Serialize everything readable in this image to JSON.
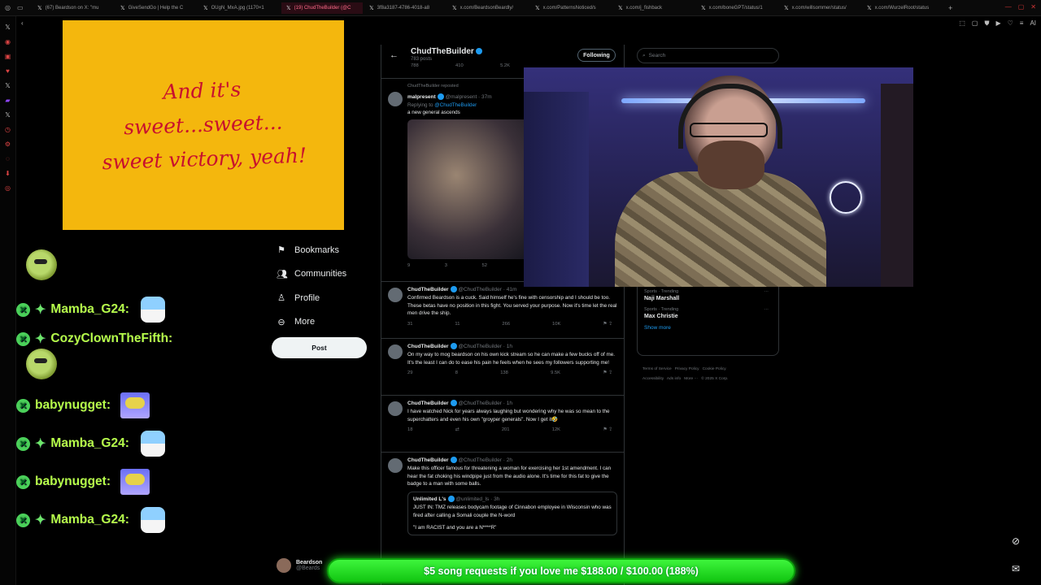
{
  "browser": {
    "tabs": [
      {
        "label": "(67) Beardson on X: \"mu",
        "active": false
      },
      {
        "label": "GiveSendGo | Help the C",
        "active": false
      },
      {
        "label": "OUgN_MxA.jpg (1170×1",
        "active": false
      },
      {
        "label": "(19) ChudTheBuilder (@C",
        "active": true
      },
      {
        "label": "3f8a3187-4786-4018-a8",
        "active": false
      },
      {
        "label": "x.com/BeardsonBeardly/",
        "active": false
      },
      {
        "label": "x.com/PatternsNoticed/s",
        "active": false
      },
      {
        "label": "x.com/j_fishback",
        "active": false
      },
      {
        "label": "x.com/boneGPT/status/1",
        "active": false
      },
      {
        "label": "x.com/willsommer/status/",
        "active": false
      },
      {
        "label": "x.com/WurzelRoot/status",
        "active": false
      }
    ],
    "ai_label": "AI"
  },
  "overlay_image": {
    "lines": [
      "And it's",
      "sweet...sweet...",
      "sweet victory, yeah!"
    ]
  },
  "chat": [
    {
      "user": "Mamba_G24:",
      "emote": "girl"
    },
    {
      "user": "CozyClownTheFifth:",
      "emote": "frog"
    },
    {
      "user": "babynugget:",
      "emote": "bot"
    },
    {
      "user": "Mamba_G24:",
      "emote": "girl"
    },
    {
      "user": "babynugget:",
      "emote": "bot"
    },
    {
      "user": "Mamba_G24:",
      "emote": "girl"
    }
  ],
  "x_nav": {
    "items": [
      {
        "label": "Bookmarks",
        "icon": "bookmark-icon"
      },
      {
        "label": "Communities",
        "icon": "people-icon"
      },
      {
        "label": "Profile",
        "icon": "person-icon"
      },
      {
        "label": "More",
        "icon": "more-circle-icon"
      }
    ],
    "post_label": "Post",
    "account_name": "Beardson",
    "account_handle": "@Beards"
  },
  "profile": {
    "name": "ChudTheBuilder",
    "posts_count": "783 posts",
    "following_label": "Following"
  },
  "search": {
    "placeholder": "Search"
  },
  "tweets": [
    {
      "reposted": "ChudTheBuilder reposted",
      "name": "malpresent",
      "handle": "@malpresent · 37m",
      "reply_to_prefix": "Replying to",
      "reply_to": "@ChudTheBuilder",
      "text": "a new general ascends",
      "has_image": true,
      "actions": [
        "9",
        "3",
        "52",
        "",
        ""
      ],
      "top_actions": [
        "788",
        "410",
        "5.2K",
        "",
        ""
      ]
    },
    {
      "name": "ChudTheBuilder",
      "handle": "@ChudTheBuilder · 41m",
      "text": "Confirmed Beardson is a cuck. Said himself he's fine with censorship and I should be too. These betas have no position in this fight. You served your purpose. Now it's time let the real men drive the ship.",
      "actions": [
        "31",
        "11",
        "266",
        "10K",
        ""
      ]
    },
    {
      "name": "ChudTheBuilder",
      "handle": "@ChudTheBuilder · 1h",
      "text": "On my way to mog beardson on his own kick stream so he can make a few bucks off of me. It's the least I can do to ease his pain he feels when he sees my followers supporting me!",
      "actions": [
        "29",
        "8",
        "138",
        "9.5K",
        ""
      ]
    },
    {
      "name": "ChudTheBuilder",
      "handle": "@ChudTheBuilder · 1h",
      "text": "I have watched Nick for years always laughing but wondering why he was so mean to the superchatters and even his own \"groyper generals\". Now I get it🤣",
      "actions": [
        "18",
        "",
        "201",
        "12K",
        ""
      ]
    },
    {
      "name": "ChudTheBuilder",
      "handle": "@ChudTheBuilder · 2h",
      "text": "Make this officer famous for threatening a woman for exercising her 1st amendment. I can hear the fat choking his windpipe just from the audio alone. It's time for this fat to give the badge to a man with some balls.",
      "quote": {
        "name": "Unlimited L's",
        "handle": "@unlimited_ls · 3h",
        "text": "JUST IN: TMZ releases bodycam footage of Cinnabon employee in Wisconsin who was fired after calling a Somali couple the N-word",
        "text2": "\"I am RACIST and you are a N****R\""
      }
    }
  ],
  "trends": [
    {
      "category": "Sports · Trending",
      "name": "Naji Marshall"
    },
    {
      "category": "Sports · Trending",
      "name": "Max Christie"
    }
  ],
  "show_more": "Show more",
  "footer": [
    "Terms of Service",
    "Privacy Policy",
    "Cookie Policy",
    "Accessibility",
    "Ads info",
    "More ···",
    "© 2025 X Corp."
  ],
  "donation": {
    "text": "$5 song requests if you love me $188.00 / $100.00 (188%)",
    "progress_percent": 188
  }
}
